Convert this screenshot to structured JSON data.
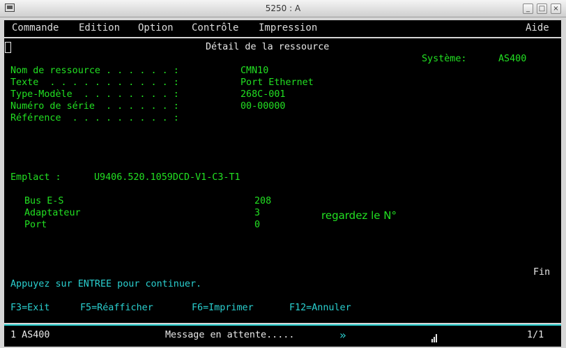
{
  "window": {
    "title": "5250 : A"
  },
  "menubar": {
    "items": [
      "Commande",
      "Edition",
      "Option",
      "Contrôle",
      "Impression"
    ],
    "help": "Aide"
  },
  "screen": {
    "title": "Détail de la ressource",
    "system_label": "Système:",
    "system_value": "AS400",
    "fields": [
      {
        "label": "Nom de ressource . . . . . . :",
        "value": "CMN10"
      },
      {
        "label": "Texte  . . . . . . . . . . . :",
        "value": "Port Ethernet"
      },
      {
        "label": "Type-Modèle  . . . . . . . . :",
        "value": "268C-001"
      },
      {
        "label": "Numéro de série  . . . . . . :",
        "value": "00-00000"
      },
      {
        "label": "Référence  . . . . . . . . . :",
        "value": ""
      }
    ],
    "location_label": "Emplact :",
    "location_value": "U9406.520.1059DCD-V1-C3-T1",
    "details": [
      {
        "label": "Bus E-S",
        "value": "208"
      },
      {
        "label": "Adaptateur",
        "value": "3"
      },
      {
        "label": "Port",
        "value": "0"
      }
    ],
    "annotation": "regardez le N°",
    "end_marker": "Fin",
    "prompt": "Appuyez sur ENTREE pour continuer.",
    "function_keys": [
      "F3=Exit",
      "F5=Réafficher",
      "F6=Imprimer",
      "F12=Annuler"
    ]
  },
  "statusbar": {
    "session": "1 AS400",
    "message": "Message en attente.....",
    "arrow": "»",
    "page": "1/1"
  }
}
